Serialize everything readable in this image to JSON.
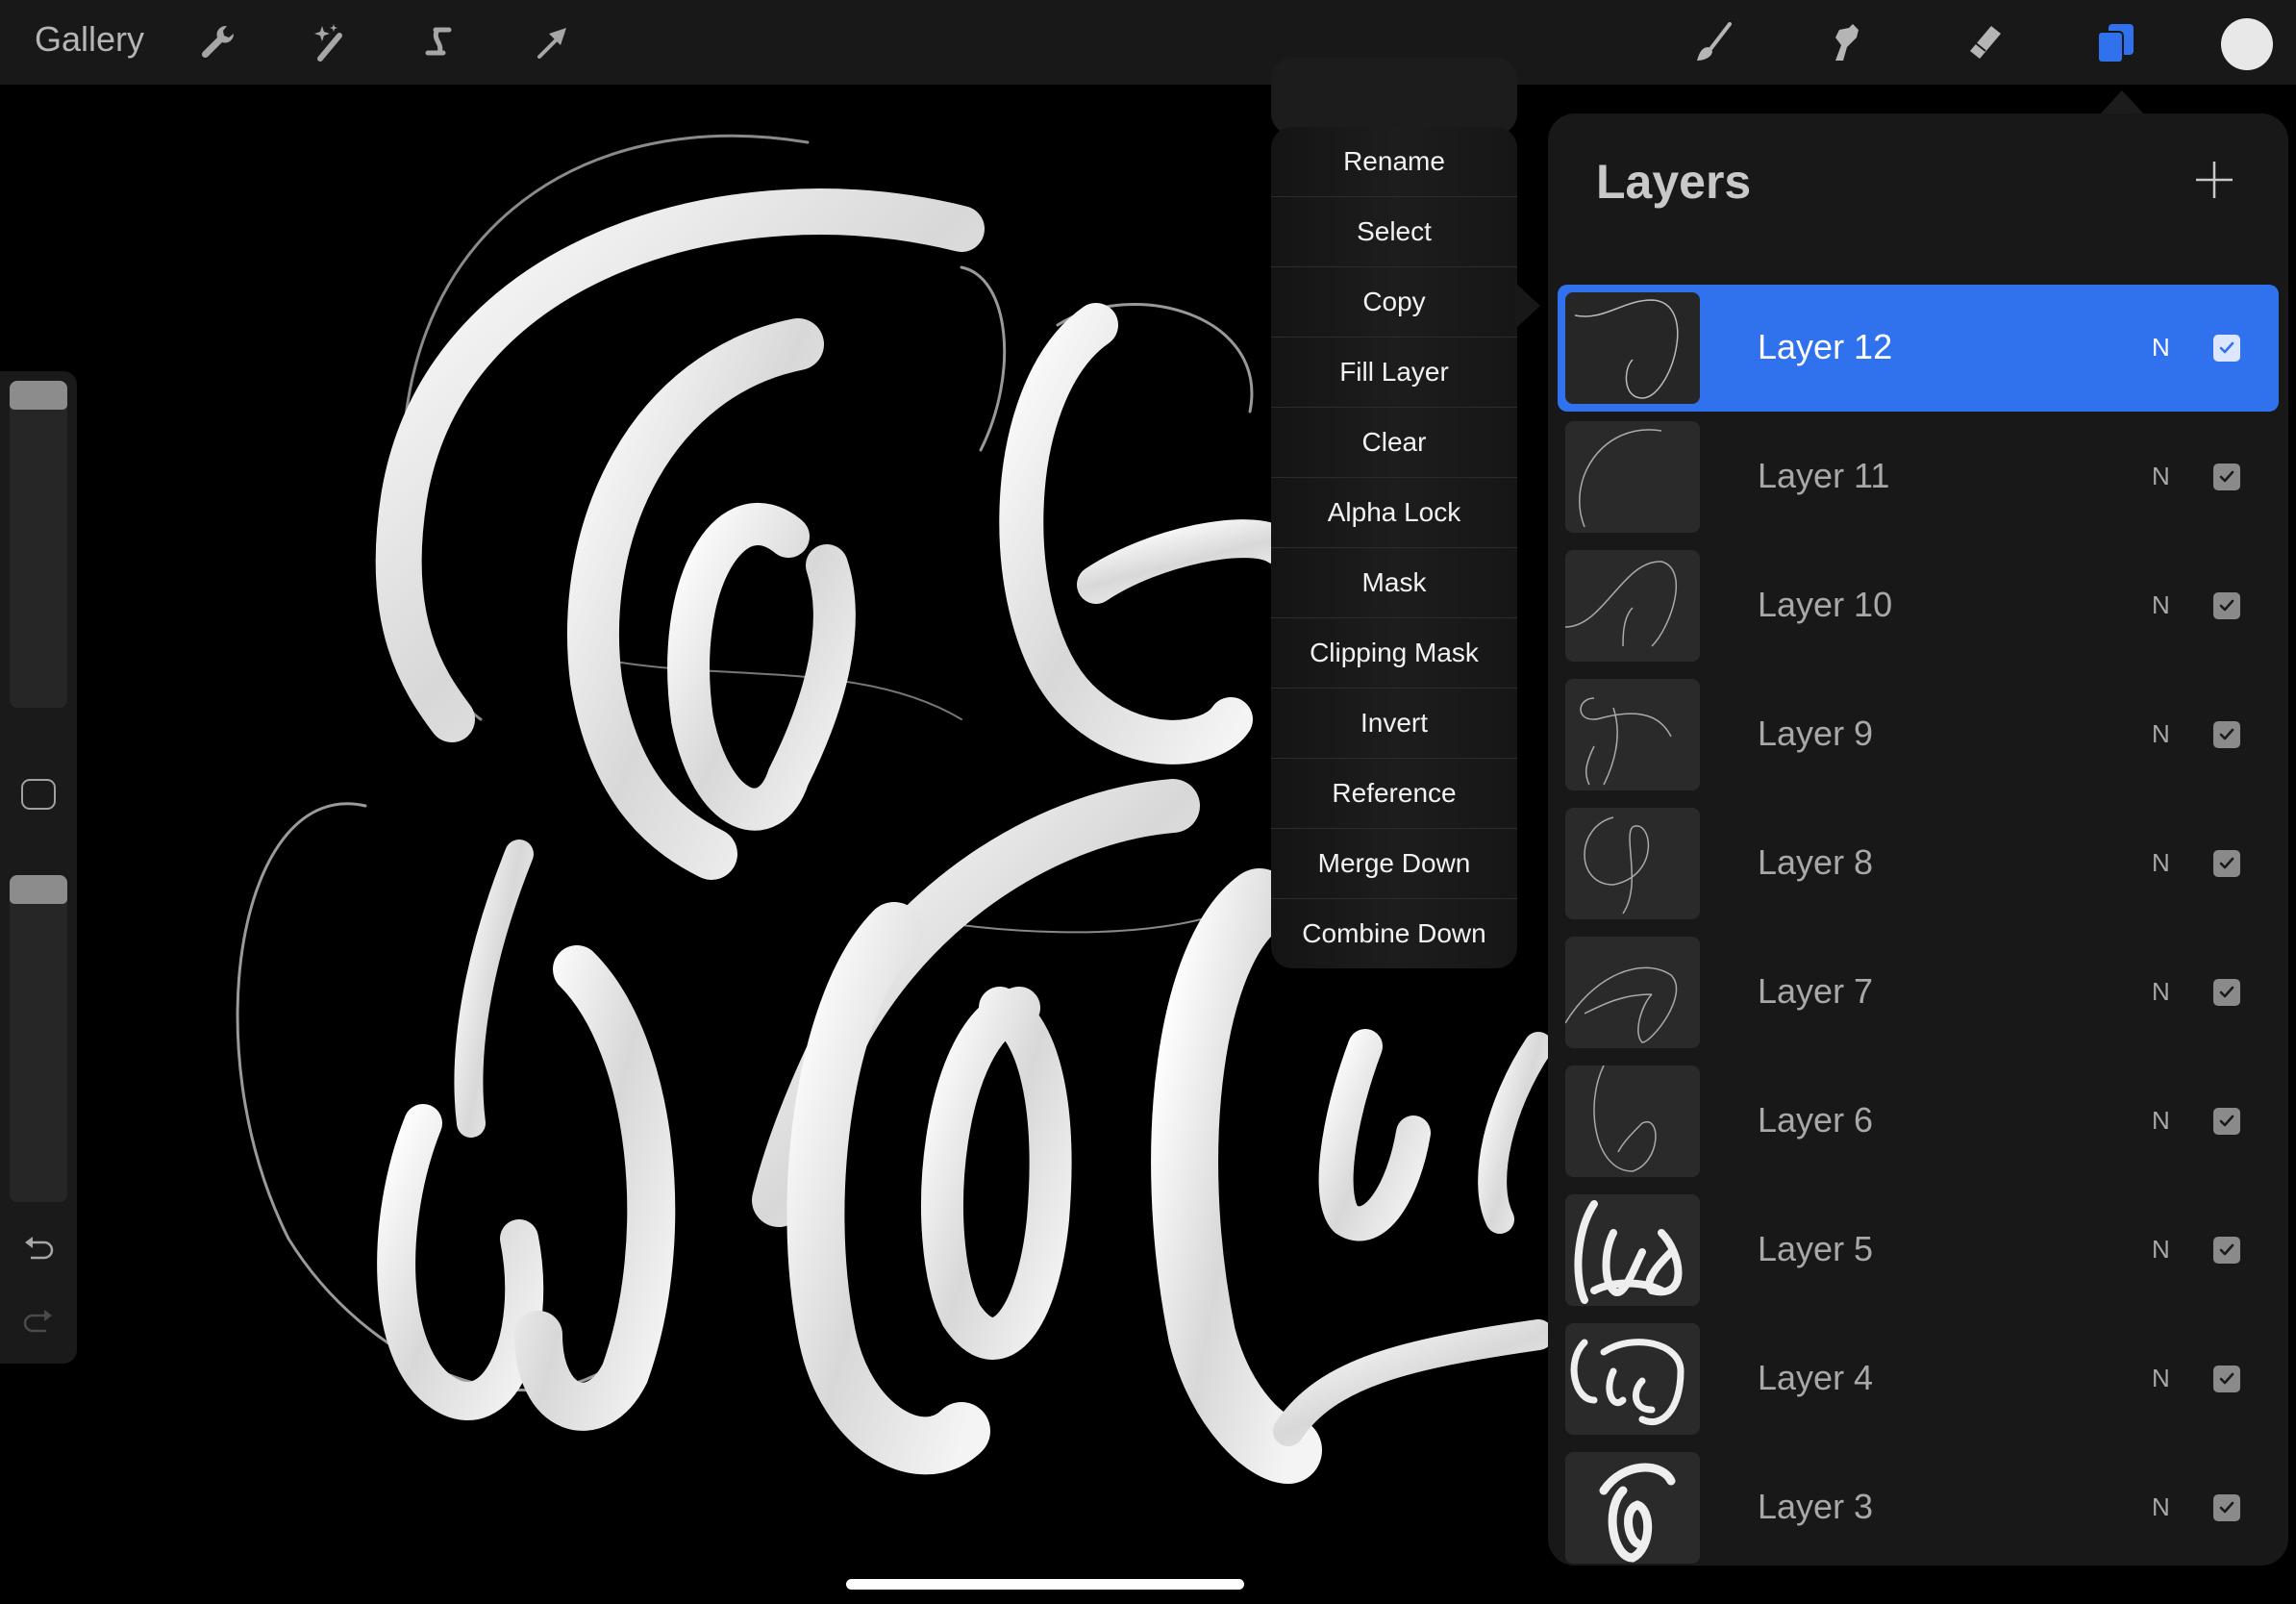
{
  "toolbar": {
    "gallery_label": "Gallery",
    "left_tools": [
      {
        "name": "actions",
        "icon": "wrench-icon"
      },
      {
        "name": "adjustments",
        "icon": "magic-wand-icon"
      },
      {
        "name": "selection",
        "icon": "selection-s-icon"
      },
      {
        "name": "transform",
        "icon": "arrow-cursor-icon"
      }
    ],
    "right_tools": [
      {
        "name": "brush",
        "icon": "paintbrush-icon"
      },
      {
        "name": "smudge",
        "icon": "smudge-finger-icon"
      },
      {
        "name": "eraser",
        "icon": "eraser-icon"
      },
      {
        "name": "layers",
        "icon": "layers-icon",
        "active": true
      }
    ],
    "current_color": "#e8e8e8",
    "accent_color": "#3072ee"
  },
  "sidebar": {
    "brush_size": 1.0,
    "brush_opacity": 1.0
  },
  "context_menu": {
    "items": [
      "Rename",
      "Select",
      "Copy",
      "Fill Layer",
      "Clear",
      "Alpha Lock",
      "Mask",
      "Clipping Mask",
      "Invert",
      "Reference",
      "Merge Down",
      "Combine Down"
    ]
  },
  "layers_panel": {
    "title": "Layers",
    "layers": [
      {
        "name": "Layer 12",
        "blend": "N",
        "visible": true,
        "active": true
      },
      {
        "name": "Layer 11",
        "blend": "N",
        "visible": true,
        "active": false
      },
      {
        "name": "Layer 10",
        "blend": "N",
        "visible": true,
        "active": false
      },
      {
        "name": "Layer 9",
        "blend": "N",
        "visible": true,
        "active": false
      },
      {
        "name": "Layer 8",
        "blend": "N",
        "visible": true,
        "active": false
      },
      {
        "name": "Layer 7",
        "blend": "N",
        "visible": true,
        "active": false
      },
      {
        "name": "Layer 6",
        "blend": "N",
        "visible": true,
        "active": false
      },
      {
        "name": "Layer 5",
        "blend": "N",
        "visible": true,
        "active": false
      },
      {
        "name": "Layer 4",
        "blend": "N",
        "visible": true,
        "active": false
      },
      {
        "name": "Layer 3",
        "blend": "N",
        "visible": true,
        "active": false
      }
    ]
  }
}
